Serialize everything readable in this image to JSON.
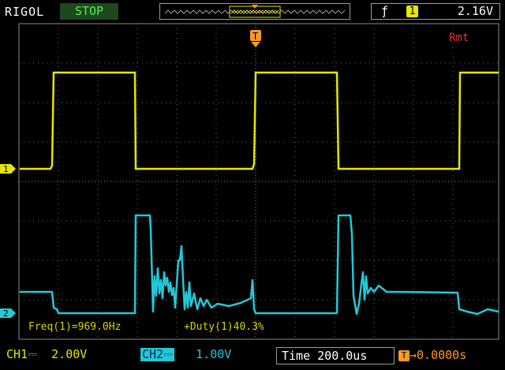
{
  "header": {
    "brand": "RIGOL",
    "run_state": "STOP",
    "trigger_slope_icon": "rising-edge-icon",
    "trigger_source": "1",
    "trigger_level": "2.16V"
  },
  "screen": {
    "remote_indicator": "Rmt",
    "trigger_marker": "T",
    "ch1_marker": "1",
    "ch2_marker": "2",
    "measurements": {
      "frequency": "Freq(1)=969.0Hz",
      "duty": "+Duty(1)40.3%"
    }
  },
  "footer": {
    "ch1_label": "CH1",
    "ch1_coupling": "⎓",
    "ch1_scale": "2.00V",
    "ch2_label": "CH2",
    "ch2_coupling": "⎓",
    "ch2_scale": "1.00V",
    "time_label": "Time",
    "time_scale": "200.0us",
    "trigger_position": "→0.0000s"
  },
  "colors": {
    "ch1": "#e6e600",
    "ch2": "#22c8d8",
    "grid": "#7a7a7a",
    "remote": "#e03030",
    "trigger": "#ff9a20"
  }
}
